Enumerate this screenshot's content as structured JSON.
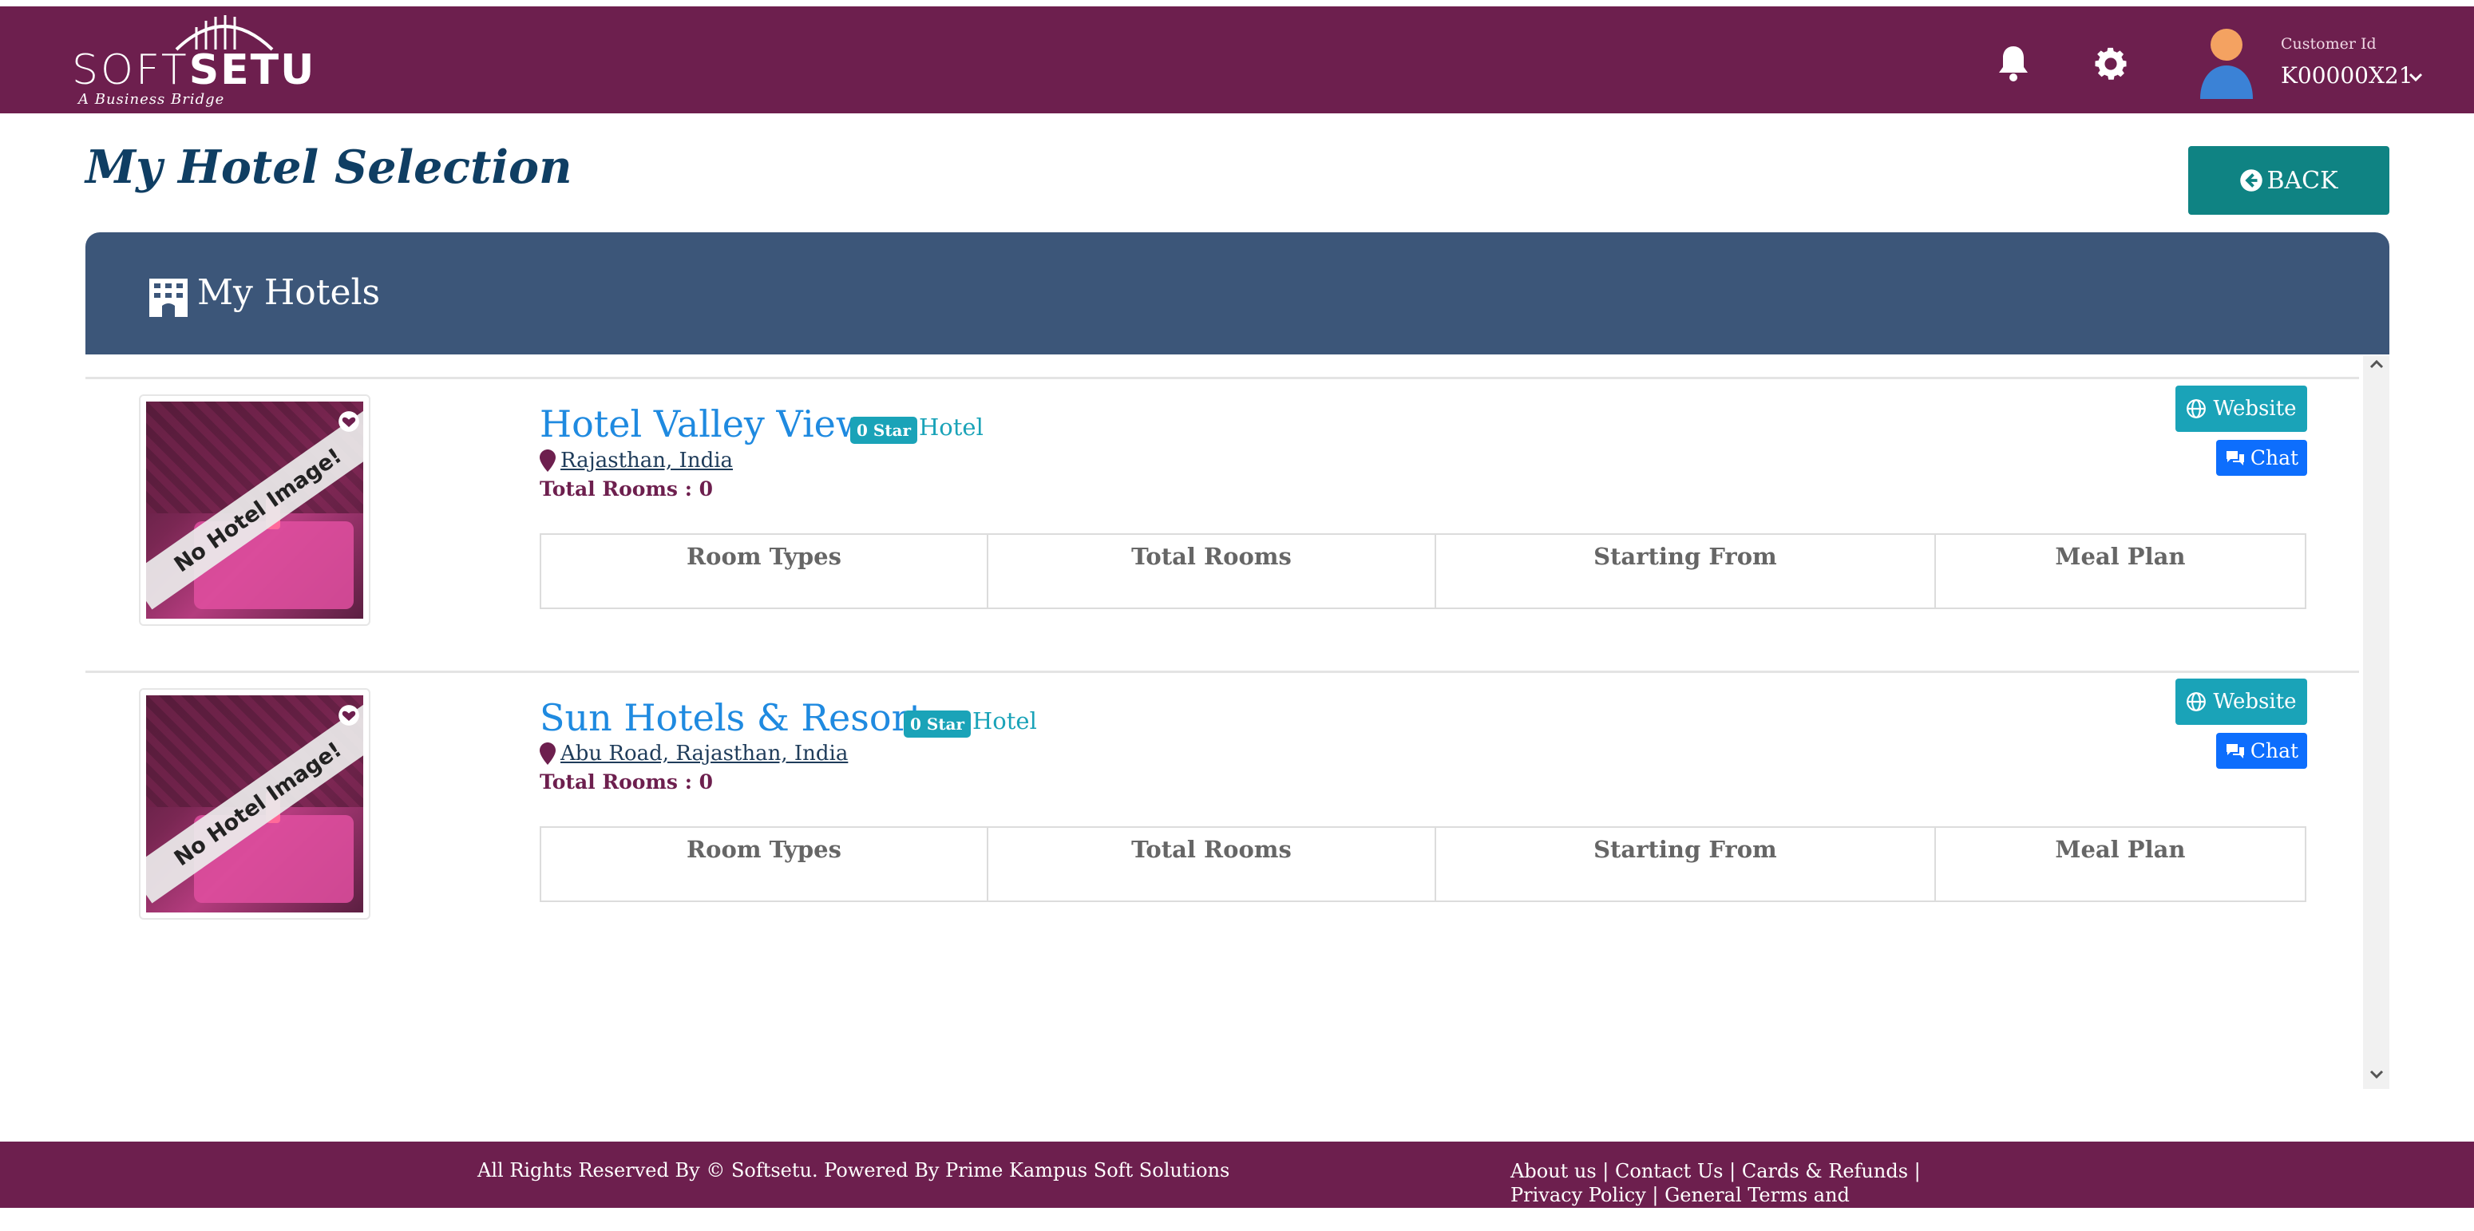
{
  "header": {
    "logo_soft": "SOFT",
    "logo_setu": "SETU",
    "logo_tagline": "A Business Bridge",
    "customer_label": "Customer Id",
    "customer_id": "K00000X21"
  },
  "page": {
    "title": "My Hotel Selection",
    "back_label": "BACK"
  },
  "card": {
    "title": "My Hotels"
  },
  "room_table_headers": [
    "Room Types",
    "Total Rooms",
    "Starting From",
    "Meal Plan"
  ],
  "hotels": [
    {
      "name": "Hotel Valley View",
      "star": "0 Star",
      "type": "Hotel",
      "location": "Rajasthan, India",
      "total_rooms": "Total Rooms : 0",
      "image_text": "No Hotel Image!",
      "website_label": "Website",
      "chat_label": "Chat"
    },
    {
      "name": "Sun Hotels & Resorts",
      "star": "0 Star",
      "type": "Hotel",
      "location": "Abu Road, Rajasthan, India",
      "total_rooms": "Total Rooms : 0",
      "image_text": "No Hotel Image!",
      "website_label": "Website",
      "chat_label": "Chat"
    }
  ],
  "footer": {
    "copyright": "All Rights Reserved By © Softsetu. Powered By Prime Kampus Soft Solutions",
    "links": [
      "About us",
      "Contact Us",
      "Cards & Refunds",
      "Privacy Policy",
      "General Terms and Conditions"
    ],
    "separator": " | "
  },
  "icons": {
    "bell": "bell-icon",
    "gear": "gear-icon",
    "avatar": "user-avatar",
    "back": "arrow-circle-left-icon",
    "building": "building-icon",
    "globe": "globe-icon",
    "chat": "chat-icon",
    "location": "map-marker-icon",
    "heart": "heart-icon"
  },
  "colors": {
    "brand": "#6d1f4e",
    "title": "#0f3e63",
    "back_button": "#0f8383",
    "card_header": "#3c5679",
    "hotel_name": "#1f8ae0",
    "badge": "#1aa3b8",
    "chat_button": "#0d6efd"
  }
}
